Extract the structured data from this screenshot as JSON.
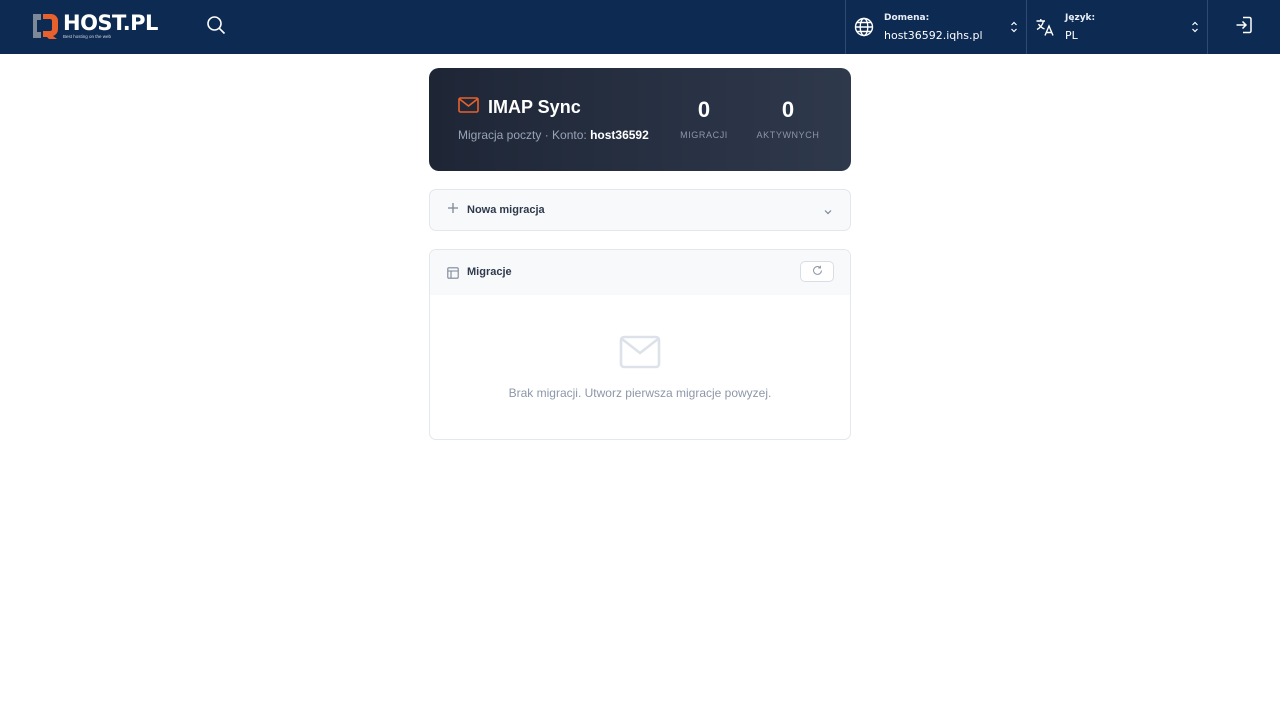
{
  "header": {
    "brand": "HOST.PL",
    "tagline": "Best hosting on the web",
    "domain_label": "Domena:",
    "domain_value": "host36592.iqhs.pl",
    "language_label": "Język:",
    "language_value": "PL",
    "icons": [
      "search-icon",
      "globe-icon",
      "translate-icon",
      "logout-icon"
    ]
  },
  "hero": {
    "title": "IMAP Sync",
    "subtitle_prefix": "Migracja poczty · Konto:",
    "account": "host36592",
    "stats": [
      {
        "value": "0",
        "label": "MIGRACJI"
      },
      {
        "value": "0",
        "label": "AKTYWNYCH"
      }
    ]
  },
  "new_migration": {
    "label": "Nowa migracja"
  },
  "migrations": {
    "title": "Migracje",
    "empty_message": "Brak migracji. Utworz pierwsza migracje powyzej."
  },
  "colors": {
    "topbar": "#0c2a52",
    "accent": "#e8612c",
    "hero_start": "#1e2636",
    "hero_end": "#2f394c"
  }
}
